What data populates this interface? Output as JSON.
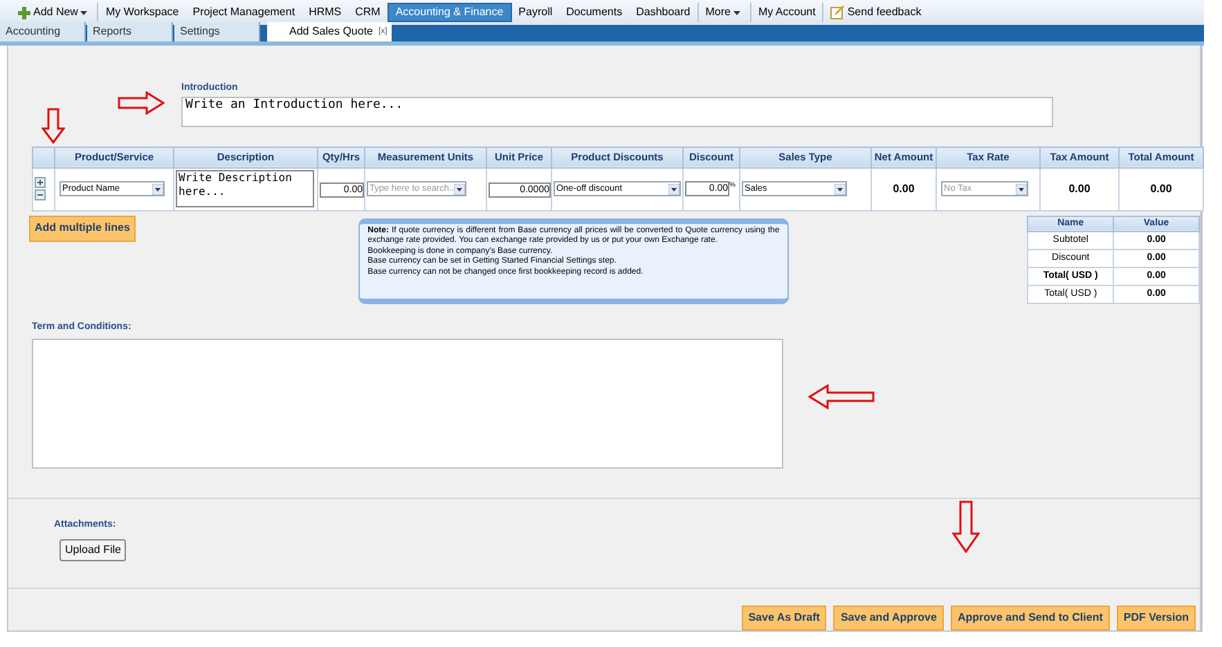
{
  "nav": [
    {
      "label": "Add New",
      "kind": "add",
      "selected": false
    },
    {
      "label": "My Workspace",
      "kind": "link",
      "selected": false
    },
    {
      "label": "Project Management",
      "kind": "link",
      "selected": false
    },
    {
      "label": "HRMS",
      "kind": "link",
      "selected": false
    },
    {
      "label": "CRM",
      "kind": "link",
      "selected": false
    },
    {
      "label": "Accounting & Finance",
      "kind": "link",
      "selected": true
    },
    {
      "label": "Payroll",
      "kind": "link",
      "selected": false
    },
    {
      "label": "Documents",
      "kind": "link",
      "selected": false
    },
    {
      "label": "Dashboard",
      "kind": "link",
      "selected": false
    },
    {
      "label": "More",
      "kind": "menu",
      "selected": false
    },
    {
      "label": "My Account",
      "kind": "link",
      "selected": false
    },
    {
      "label": "Send feedback",
      "kind": "feedback",
      "selected": false
    }
  ],
  "tabs": [
    {
      "label": "Accounting",
      "selected": false
    },
    {
      "label": "Reports",
      "selected": false
    },
    {
      "label": "Settings",
      "selected": false
    },
    {
      "label": "Add Sales Quote",
      "selected": true,
      "close": "[x]"
    }
  ],
  "introduction": {
    "label": "Introduction",
    "value": "Write an Introduction here..."
  },
  "table": {
    "columns": [
      "Product/Service",
      "Description",
      "Qty/Hrs",
      "Measurement Units",
      "Unit Price",
      "Product Discounts",
      "Discount",
      "Sales Type",
      "Net Amount",
      "Tax Rate",
      "Tax Amount",
      "Total Amount"
    ],
    "row": {
      "product": "Product Name",
      "description": "Write Description here...",
      "qty": "0.00",
      "units_placeholder": "Type here to search..",
      "unit_price": "0.0000",
      "product_discount": "One-off discount",
      "discount": "0.00",
      "discount_unit": "%",
      "sales_type": "Sales",
      "net_amount": "0.00",
      "tax_rate": "No Tax",
      "tax_amount": "0.00",
      "total_amount": "0.00"
    }
  },
  "add_lines_button": "Add multiple lines",
  "note": [
    "**Note:** If quote currency is different from Base currency all prices will be converted to Quote currency using the exchange rate provided. You can exchange rate provided by us or put your own Exchange rate.",
    "Bookkeeping is done in company's Base currency.",
    "Base currency can be set in Getting Started Financial Settings step.",
    "Base currency can not be changed once first bookkeeping record is added."
  ],
  "totals": {
    "columns": [
      "Name",
      "Value"
    ],
    "rows": [
      {
        "name": "Subtotel",
        "value": "0.00",
        "bold": false
      },
      {
        "name": "Discount",
        "value": "0.00",
        "bold": false
      },
      {
        "name": "Total( USD )",
        "value": "0.00",
        "bold": true
      },
      {
        "name": "Total( USD )",
        "value": "0.00",
        "bold": false
      }
    ]
  },
  "terms": {
    "label": "Term and Conditions:"
  },
  "attachments": {
    "label": "Attachments:",
    "button": "Upload File"
  },
  "buttons": [
    "Save As Draft",
    "Save and Approve",
    "Approve and Send to Client",
    "PDF Version"
  ]
}
